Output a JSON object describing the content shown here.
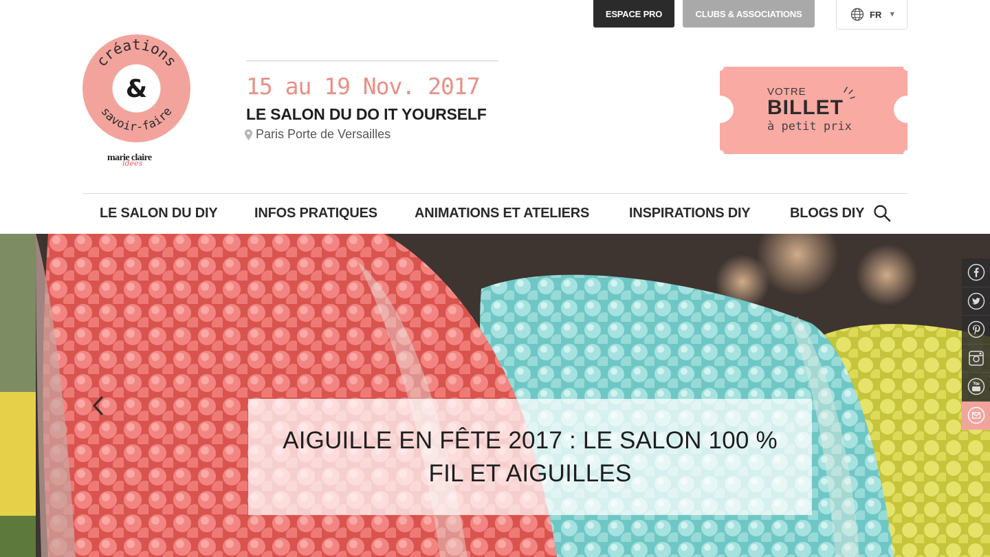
{
  "topbar": {
    "espace_pro": "ESPACE PRO",
    "clubs": "CLUBS & ASSOCIATIONS",
    "language": "FR",
    "globe_icon": "globe-icon"
  },
  "logo": {
    "top_word": "créations",
    "ampersand": "&",
    "bottom_word": "savoir-faire",
    "brand": "marie claire",
    "brand_sub": "idées",
    "color": "#f2a49c"
  },
  "event": {
    "date": "15 au 19 Nov. 2017",
    "title": "LE SALON DU DO IT YOURSELF",
    "place": "Paris Porte de Versailles"
  },
  "ticket": {
    "line1": "VOTRE",
    "line2": "BILLET",
    "line3": "à petit prix",
    "color": "#f8aaa3"
  },
  "nav": {
    "items": [
      "LE SALON DU DIY",
      "INFOS PRATIQUES",
      "ANIMATIONS ET ATELIERS",
      "INSPIRATIONS DIY",
      "BLOGS DIY"
    ],
    "search_icon": "search-icon"
  },
  "hero": {
    "caption": "AIGUILLE EN FÊTE 2017 : LE SALON 100 % FIL ET AIGUILLES",
    "prev_icon": "chevron-left-icon"
  },
  "social": [
    "facebook-icon",
    "twitter-icon",
    "pinterest-icon",
    "instagram-icon",
    "youtube-icon",
    "mail-icon"
  ]
}
